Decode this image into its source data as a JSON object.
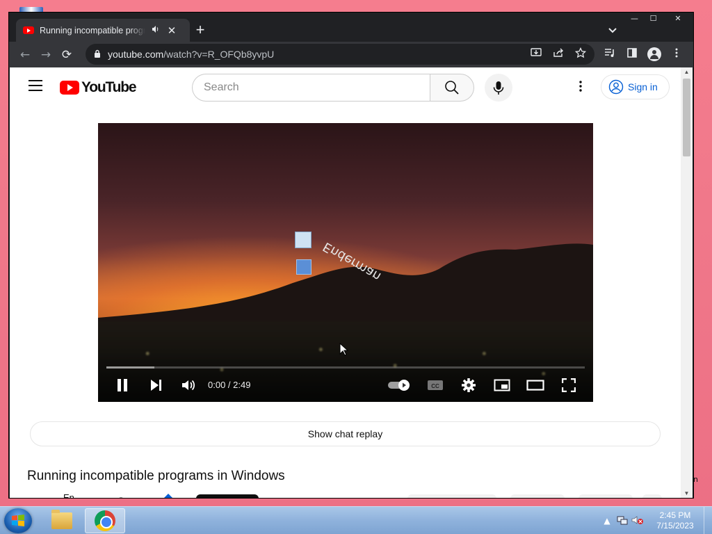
{
  "browser": {
    "tab": {
      "title": "Running incompatible programs in Windows",
      "audio_icon": "speaker-icon",
      "close": "✕"
    },
    "new_tab": "+",
    "tab_search": "⌄",
    "window_controls": {
      "minimize": "—",
      "maximize": "☐",
      "close": "✕"
    },
    "nav": {
      "back": "←",
      "forward": "→",
      "reload": "⟳"
    },
    "address": {
      "host": "youtube.com",
      "path": "/watch?v=R_OFQb8yvpU"
    },
    "omnibox_icons": [
      "install-icon",
      "share-icon",
      "star-icon"
    ],
    "toolbar_icons": [
      "reading-list-icon",
      "side-panel-icon",
      "profile-icon",
      "menu-icon"
    ]
  },
  "youtube": {
    "logo_text": "YouTube",
    "search_placeholder": "Search",
    "sign_in": "Sign in",
    "player": {
      "time": "0:00 / 2:49",
      "progress_fraction": 0.0,
      "buffered_fraction": 0.1,
      "overlay_text": "Enderman"
    },
    "chat_replay": "Show chat replay",
    "video_title": "Running incompatible programs in Windows",
    "partial_text": "Enderman"
  },
  "desktop": {
    "edge_fragment": "n"
  },
  "taskbar": {
    "clock_time": "2:45 PM",
    "clock_date": "7/15/2023",
    "tray_icons": [
      "show-hidden-icons",
      "network-icon",
      "volume-muted-icon"
    ]
  }
}
